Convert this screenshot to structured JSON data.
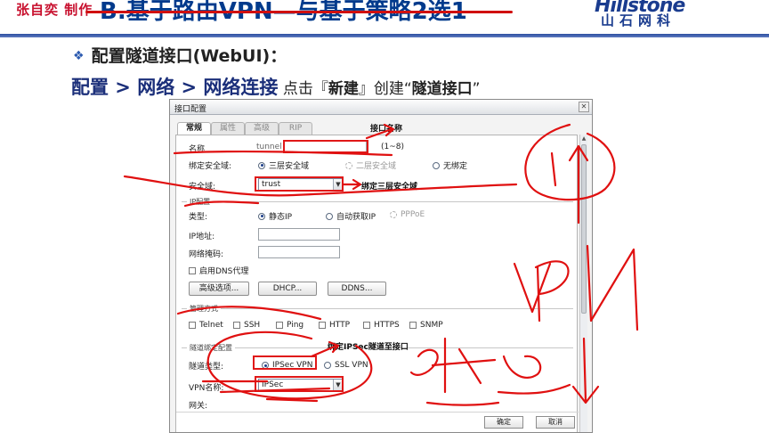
{
  "header": {
    "watermark": "张自奕 制作",
    "title": "B.基于路由VPN—与基于策略2选1",
    "logo_en": "Hillstone",
    "logo_cn": "山石网科"
  },
  "slide": {
    "bullet": "配置隧道接口(WebUI)：",
    "path": {
      "part1": "配置 > 网络 > 网络连接",
      "plain1": " 点击『",
      "bold1": "新建",
      "plain2": "』创建“",
      "bold2": "隧道接口",
      "plain3": "”"
    }
  },
  "dialog": {
    "title": "接口配置",
    "tabs": [
      "常规",
      "属性",
      "高级",
      "RIP"
    ],
    "name_label": "名称",
    "name_prefix": "tunnel",
    "name_hint": "(1~8)",
    "bind_zone_label": "绑定安全域:",
    "bind_zone_options": [
      "三层安全域",
      "二层安全域",
      "无绑定"
    ],
    "zone_label": "安全域:",
    "zone_value": "trust",
    "ip_group": "IP配置",
    "type_label": "类型:",
    "type_options": [
      "静态IP",
      "自动获取IP",
      "PPPoE"
    ],
    "ip_label": "IP地址:",
    "mask_label": "网络掩码:",
    "dns_proxy": "启用DNS代理",
    "buttons": [
      "高级选项...",
      "DHCP...",
      "DDNS..."
    ],
    "mgmt_group": "管理方式",
    "mgmt_options": [
      "Telnet",
      "SSH",
      "Ping",
      "HTTP",
      "HTTPS",
      "SNMP"
    ],
    "tunnel_group": "隧道绑定配置",
    "tunnel_type_label": "隧道类型:",
    "tunnel_type_options": [
      "IPSec VPN",
      "SSL VPN"
    ],
    "vpn_name_label": "VPN名称:",
    "vpn_name_value": "IPSec",
    "gateway_label": "网关:",
    "ok": "确定",
    "cancel": "取消"
  },
  "annotations": {
    "iface_name": "接口名称",
    "bind_l3": "绑定三层安全域",
    "bind_ipsec": "绑定IPSec隧道至接口"
  },
  "colors": {
    "brand_blue": "#1a3c8f",
    "annotation_red": "#e01818",
    "title_blue": "#003a8c"
  }
}
